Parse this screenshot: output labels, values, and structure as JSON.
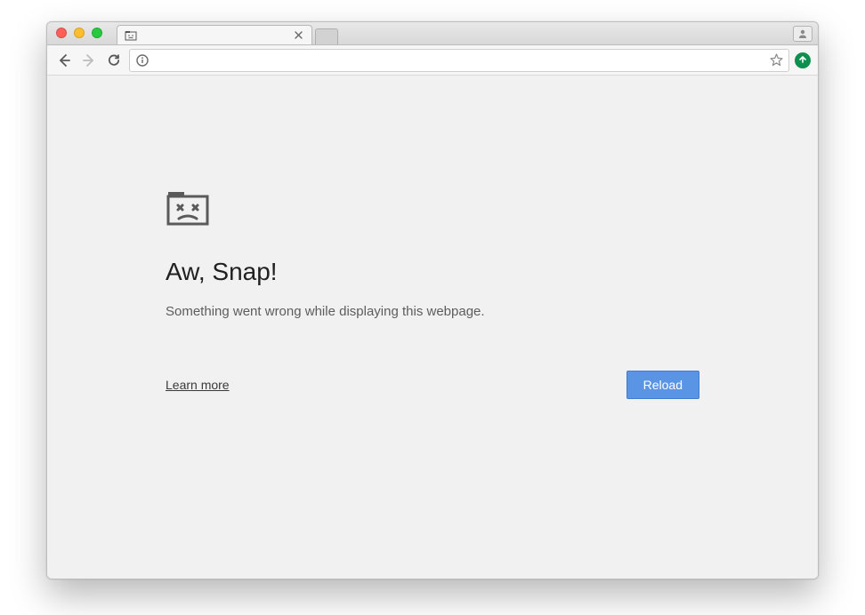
{
  "window": {
    "traffic_lights": [
      "close",
      "minimize",
      "zoom"
    ]
  },
  "tabs": {
    "active": {
      "title": "",
      "favicon": "sad-folder-icon"
    }
  },
  "toolbar": {
    "back_enabled": true,
    "forward_enabled": false,
    "reload_enabled": true,
    "omnibox_value": "",
    "info_icon": "info-icon",
    "star_icon": "star-icon",
    "extension_icon": "shield-up-icon"
  },
  "error": {
    "title": "Aw, Snap!",
    "message": "Something went wrong while displaying this webpage.",
    "learn_more_label": "Learn more",
    "reload_label": "Reload"
  }
}
